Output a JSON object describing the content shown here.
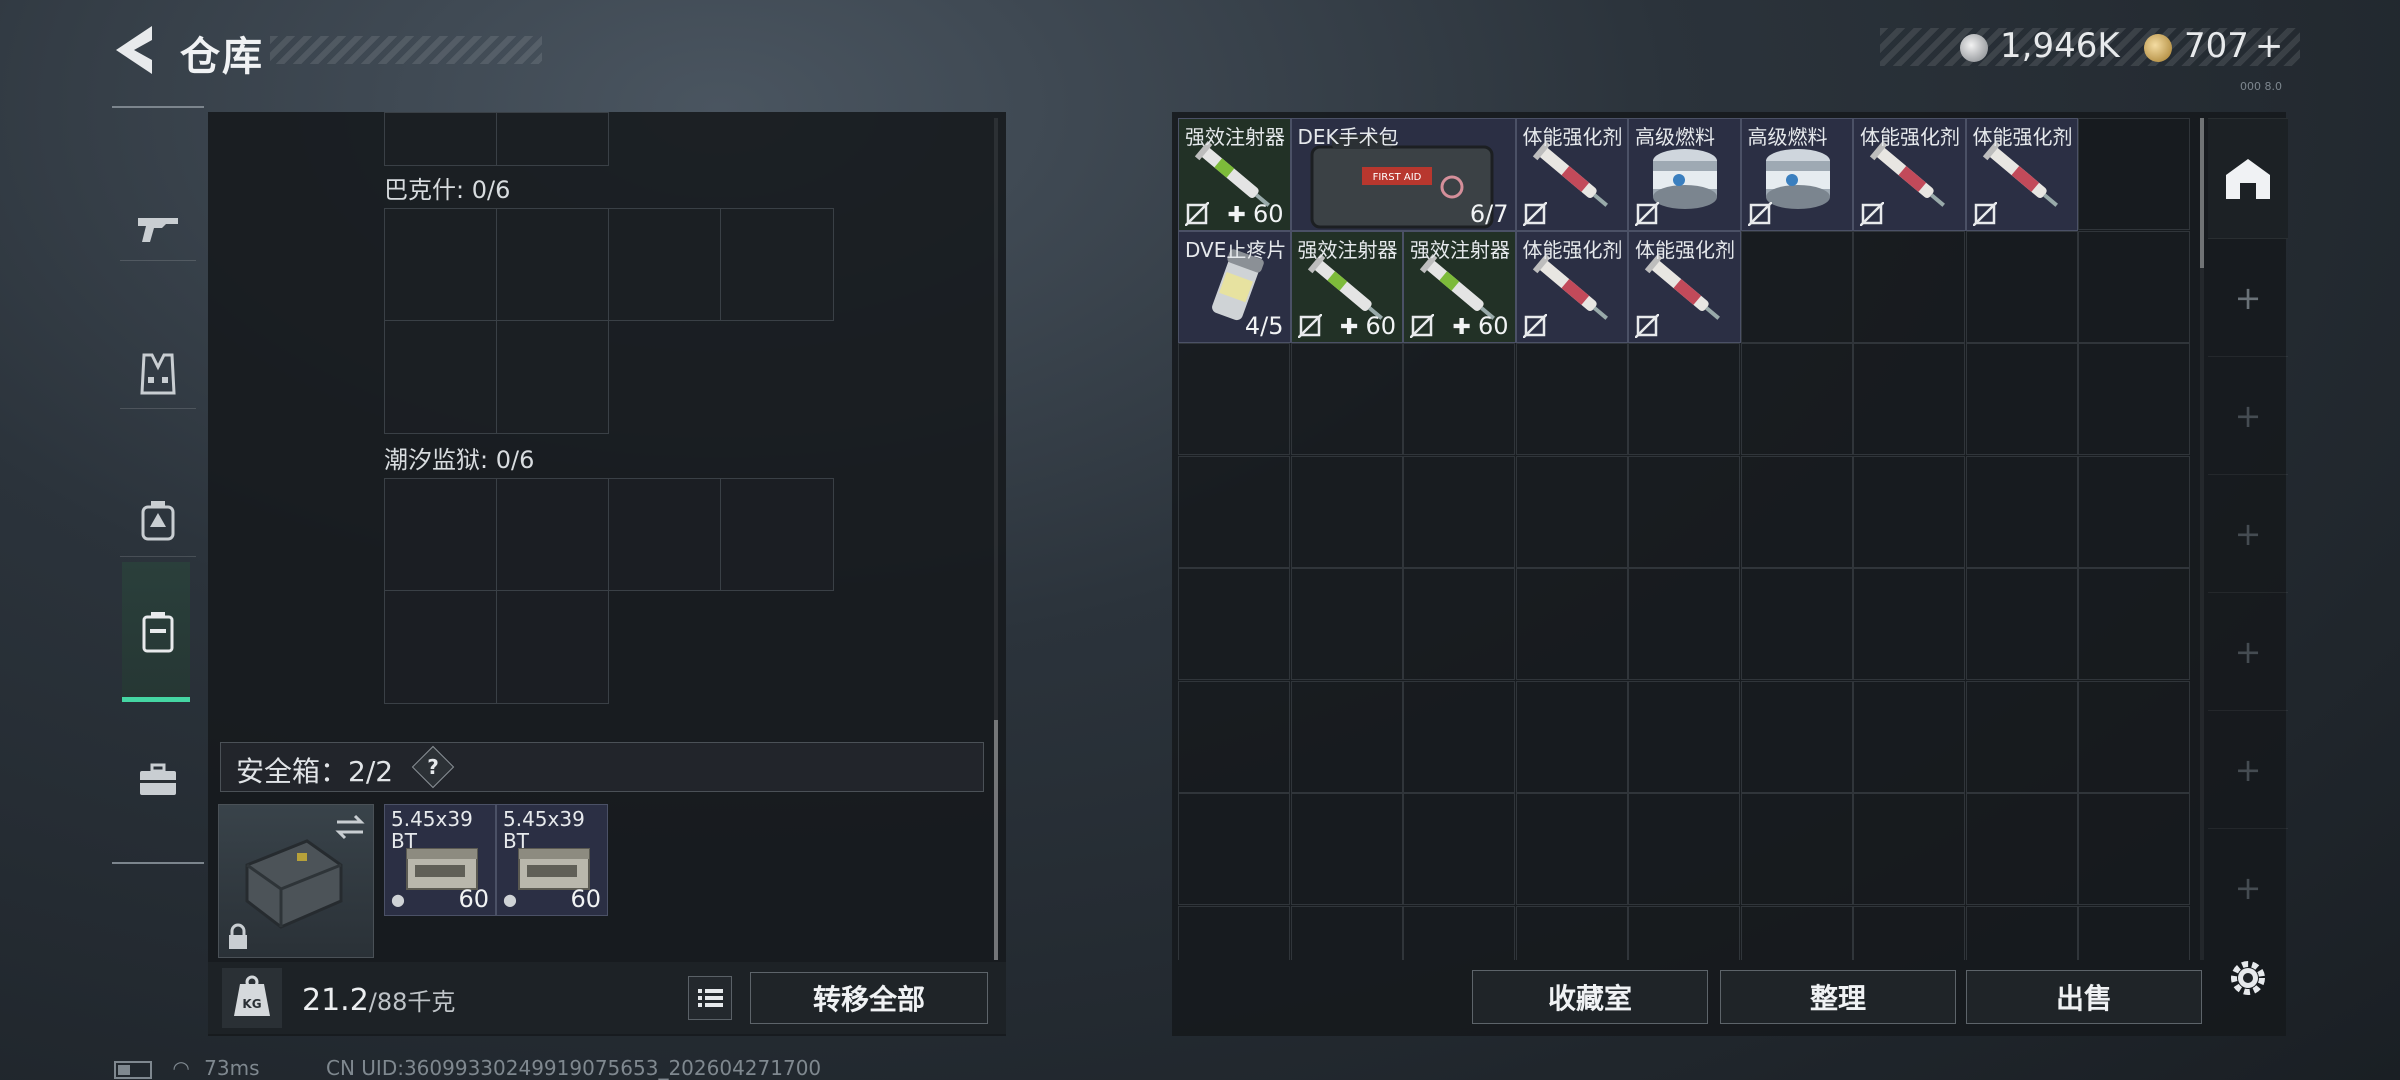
{
  "header": {
    "title": "仓库",
    "back_icon": "back-arrow-icon",
    "currency_silver": "1,946K",
    "currency_gold": "707",
    "currency_gold_suffix": "+",
    "tiny_text": "000 8.0"
  },
  "nav": {
    "items": [
      {
        "icon": "gun-icon"
      },
      {
        "icon": "vest-icon"
      },
      {
        "icon": "backpack-icon"
      },
      {
        "icon": "container-icon",
        "active": true
      },
      {
        "icon": "briefcase-icon"
      }
    ]
  },
  "left": {
    "section1_label": "巴克什: 0/6",
    "section2_label": "潮汐监狱: 0/6",
    "safe_label": "安全箱：2/2",
    "safe_help": "?",
    "ammo": [
      {
        "name": "5.45x39",
        "tag": "BT",
        "count": "60"
      },
      {
        "name": "5.45x39",
        "tag": "BT",
        "count": "60"
      }
    ],
    "weight_value": "21.2",
    "weight_max": "/88千克",
    "transfer_all": "转移全部"
  },
  "status": {
    "ping": "73ms",
    "uid": "CN UID:3609933024991907565​3_202604271700"
  },
  "right": {
    "row1": [
      {
        "name": "强效注射器",
        "count": "60",
        "plus": true,
        "bg": "#223126"
      },
      {
        "name": "DEK手术包",
        "count": "6/7",
        "wide": true,
        "bg": "#2b2f44"
      },
      {
        "name": "体能强化剂",
        "bg": "#2b2f44"
      },
      {
        "name": "高级燃料",
        "bg": "#2b2f44"
      },
      {
        "name": "高级燃料",
        "bg": "#2b2f44"
      },
      {
        "name": "体能强化剂",
        "bg": "#2b2f44"
      },
      {
        "name": "体能强化剂",
        "bg": "#2b2f44"
      }
    ],
    "row2": [
      {
        "name": "DVE止疼片",
        "count": "4/5",
        "bg": "#2b2f44"
      },
      {
        "name": "强效注射器",
        "count": "60",
        "plus": true,
        "bg": "#223126"
      },
      {
        "name": "强效注射器",
        "count": "60",
        "plus": true,
        "bg": "#223126"
      },
      {
        "name": "体能强化剂",
        "bg": "#2b2f44"
      },
      {
        "name": "体能强化剂",
        "bg": "#2b2f44"
      }
    ],
    "btn_collection": "收藏室",
    "btn_sort": "整理",
    "btn_sell": "出售"
  },
  "colors": {
    "accent": "#45d6a3",
    "item_green": "#223126",
    "item_blue": "#2b2f44"
  }
}
